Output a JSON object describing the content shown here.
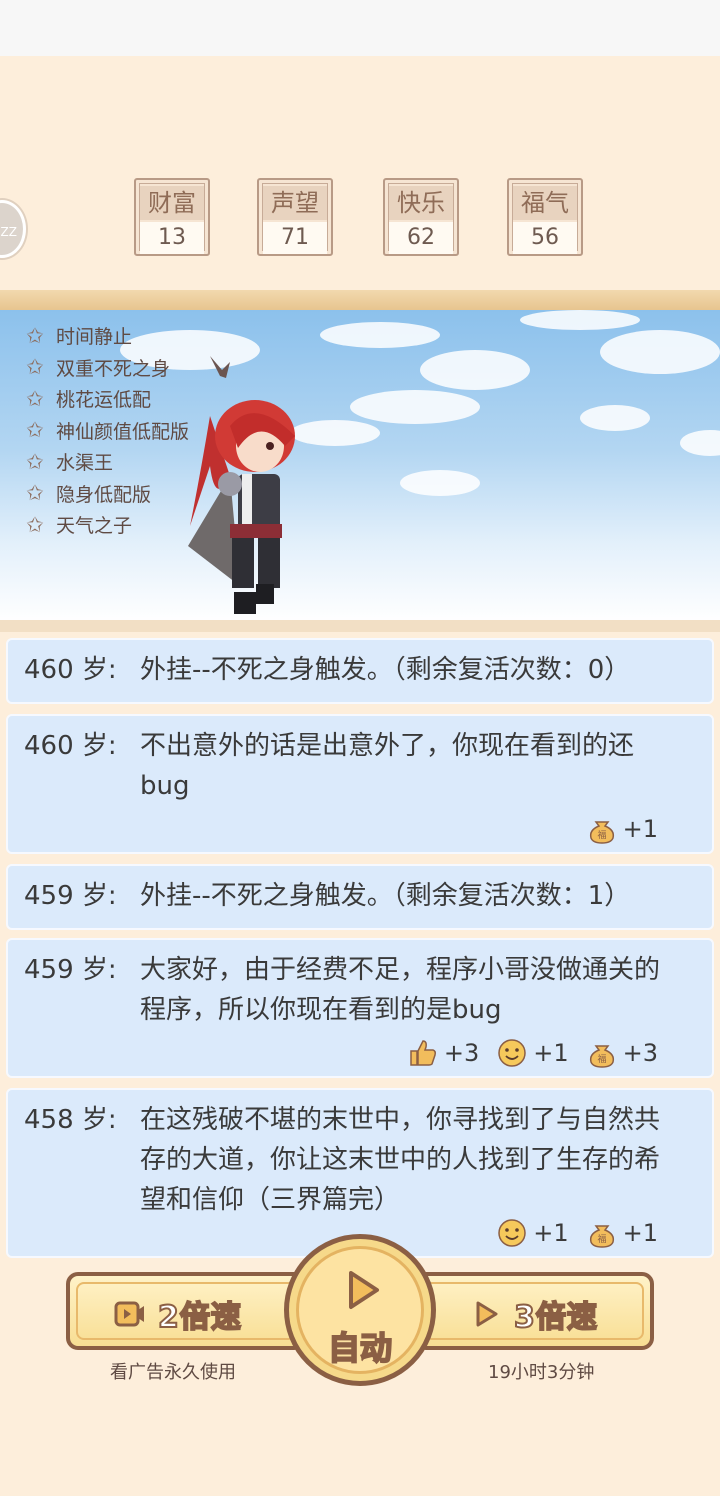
{
  "side_bubble": {
    "label": "ZZ"
  },
  "stats": [
    {
      "label": "财富",
      "value": "13"
    },
    {
      "label": "声望",
      "value": "71"
    },
    {
      "label": "快乐",
      "value": "62"
    },
    {
      "label": "福气",
      "value": "56"
    }
  ],
  "buffs": [
    "时间静止",
    "双重不死之身",
    "桃花运低配",
    "神仙颜值低配版",
    "水渠王",
    "隐身低配版",
    "天气之子"
  ],
  "logs": [
    {
      "age": "460 岁:",
      "text": "外挂--不死之身触发。（剩余复活次数：0）",
      "rewards": []
    },
    {
      "age": "460 岁:",
      "text": "不出意外的话是出意外了，你现在看到的还bug",
      "rewards": [
        {
          "icon": "lucky-bag-icon",
          "value": "+1"
        }
      ]
    },
    {
      "age": "459 岁:",
      "text": "外挂--不死之身触发。（剩余复活次数：1）",
      "rewards": []
    },
    {
      "age": "459 岁:",
      "text": "大家好，由于经费不足，程序小哥没做通关的程序，所以你现在看到的是bug",
      "rewards": [
        {
          "icon": "thumbs-up-icon",
          "value": "+3"
        },
        {
          "icon": "smiley-icon",
          "value": "+1"
        },
        {
          "icon": "lucky-bag-icon",
          "value": "+3"
        }
      ]
    },
    {
      "age": "458 岁:",
      "text": "在这残破不堪的末世中，你寻找到了与自然共存的大道，你让这末世中的人找到了生存的希望和信仰（三界篇完）",
      "rewards": [
        {
          "icon": "smiley-icon",
          "value": "+1"
        },
        {
          "icon": "lucky-bag-icon",
          "value": "+1"
        }
      ]
    }
  ],
  "controls": {
    "speed2": {
      "label": "2倍速",
      "caption": "看广告永久使用",
      "icon": "video-play-icon"
    },
    "auto": {
      "label": "自动",
      "icon": "play-icon"
    },
    "speed3": {
      "label": "3倍速",
      "caption": "19小时3分钟",
      "icon": "play-icon"
    }
  },
  "colors": {
    "background": "#fdeedb",
    "log_bg": "#dbeafb",
    "button_border": "#8b5f44",
    "button_fill": "#f8de93"
  }
}
